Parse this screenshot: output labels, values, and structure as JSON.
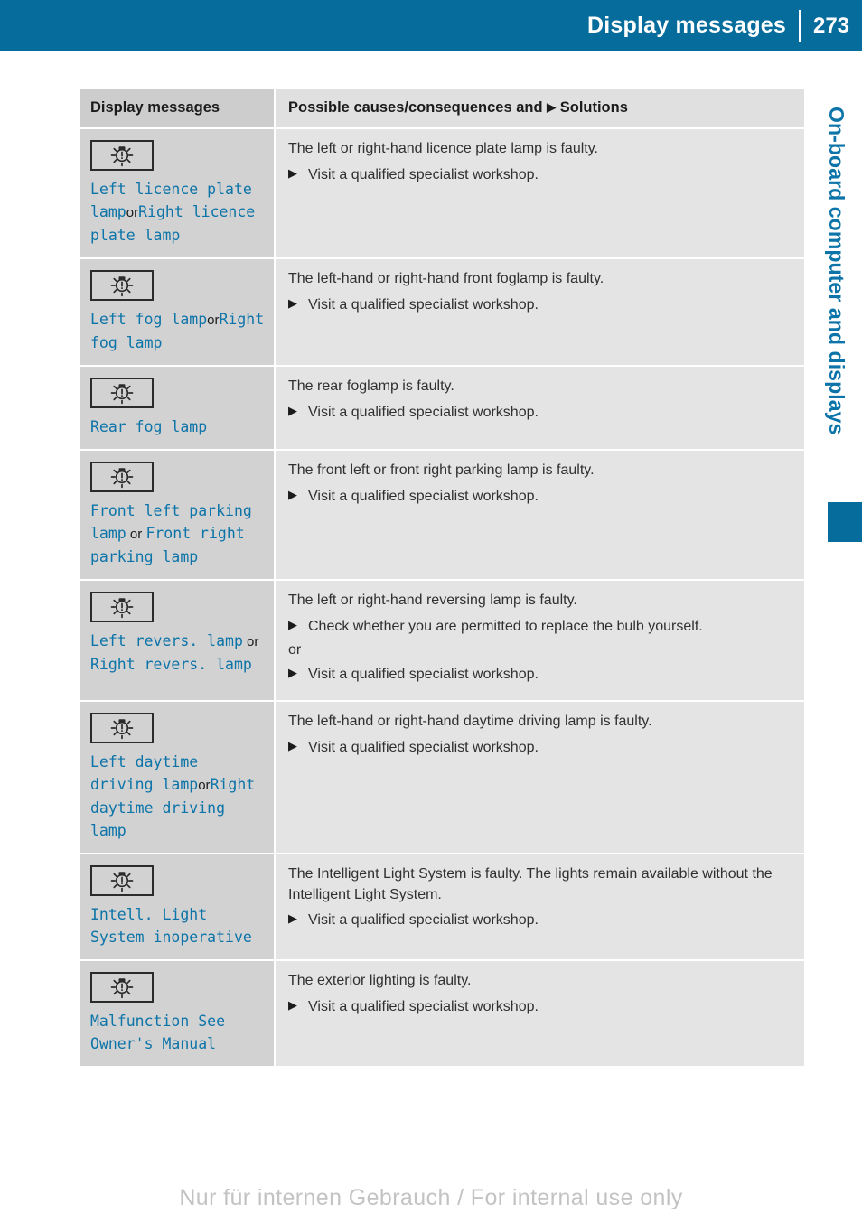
{
  "header": {
    "title": "Display messages",
    "page_number": "273"
  },
  "side_tab": {
    "label": "On-board computer and displays",
    "accent_color": "#056c9c"
  },
  "table": {
    "columns": {
      "left_header": "Display messages",
      "right_header_before": "Possible causes/consequences and",
      "right_header_triangle": "▶",
      "right_header_after": "Solutions"
    },
    "rows": [
      {
        "icon": "lamp-malfunction-icon",
        "message_parts": [
          {
            "text": "Left licence plate lamp",
            "style": "display"
          },
          {
            "text": "or",
            "style": "plain"
          },
          {
            "text": "Right licence plate lamp",
            "style": "display"
          }
        ],
        "cause": "The left or right-hand licence plate lamp is faulty.",
        "solutions": [
          {
            "type": "step",
            "text": "Visit a qualified specialist workshop."
          }
        ]
      },
      {
        "icon": "lamp-malfunction-icon",
        "message_parts": [
          {
            "text": "Left fog lamp",
            "style": "display"
          },
          {
            "text": "or",
            "style": "plain"
          },
          {
            "text": "Right fog lamp",
            "style": "display"
          }
        ],
        "cause": "The left-hand or right-hand front foglamp is faulty.",
        "solutions": [
          {
            "type": "step",
            "text": "Visit a qualified specialist workshop."
          }
        ]
      },
      {
        "icon": "lamp-malfunction-icon",
        "message_parts": [
          {
            "text": "Rear fog lamp",
            "style": "display"
          }
        ],
        "cause": "The rear foglamp is faulty.",
        "solutions": [
          {
            "type": "step",
            "text": "Visit a qualified specialist workshop."
          }
        ]
      },
      {
        "icon": "lamp-malfunction-icon",
        "message_parts": [
          {
            "text": "Front left parking lamp",
            "style": "display"
          },
          {
            "text": " or ",
            "style": "plain"
          },
          {
            "text": "Front right parking lamp",
            "style": "display"
          }
        ],
        "cause": "The front left or front right parking lamp is faulty.",
        "solutions": [
          {
            "type": "step",
            "text": "Visit a qualified specialist workshop."
          }
        ]
      },
      {
        "icon": "lamp-malfunction-icon",
        "message_parts": [
          {
            "text": "Left revers. lamp",
            "style": "display"
          },
          {
            "text": " or ",
            "style": "plain"
          },
          {
            "text": "Right revers. lamp",
            "style": "display"
          }
        ],
        "cause": "The left or right-hand reversing lamp is faulty.",
        "solutions": [
          {
            "type": "step",
            "text": "Check whether you are permitted to replace the bulb yourself."
          },
          {
            "type": "or",
            "text": "or"
          },
          {
            "type": "step",
            "text": "Visit a qualified specialist workshop."
          }
        ]
      },
      {
        "icon": "lamp-malfunction-icon",
        "message_parts": [
          {
            "text": "Left daytime driving lamp",
            "style": "display"
          },
          {
            "text": "or",
            "style": "plain"
          },
          {
            "text": "Right daytime driving lamp",
            "style": "display"
          }
        ],
        "cause": "The left-hand or right-hand daytime driving lamp is faulty.",
        "solutions": [
          {
            "type": "step",
            "text": "Visit a qualified specialist workshop."
          }
        ]
      },
      {
        "icon": "lamp-malfunction-icon",
        "message_parts": [
          {
            "text": "Intell. Light System inoperative",
            "style": "display"
          }
        ],
        "cause": "The Intelligent Light System is faulty. The lights remain available without the Intelligent Light System.",
        "solutions": [
          {
            "type": "step",
            "text": "Visit a qualified specialist workshop."
          }
        ]
      },
      {
        "icon": "lamp-malfunction-icon",
        "message_parts": [
          {
            "text": "Malfunction See Owner's Manual",
            "style": "display"
          }
        ],
        "cause": "The exterior lighting is faulty.",
        "solutions": [
          {
            "type": "step",
            "text": "Visit a qualified specialist workshop."
          }
        ]
      }
    ]
  },
  "footer": {
    "watermark": "Nur für internen Gebrauch / For internal use only"
  }
}
